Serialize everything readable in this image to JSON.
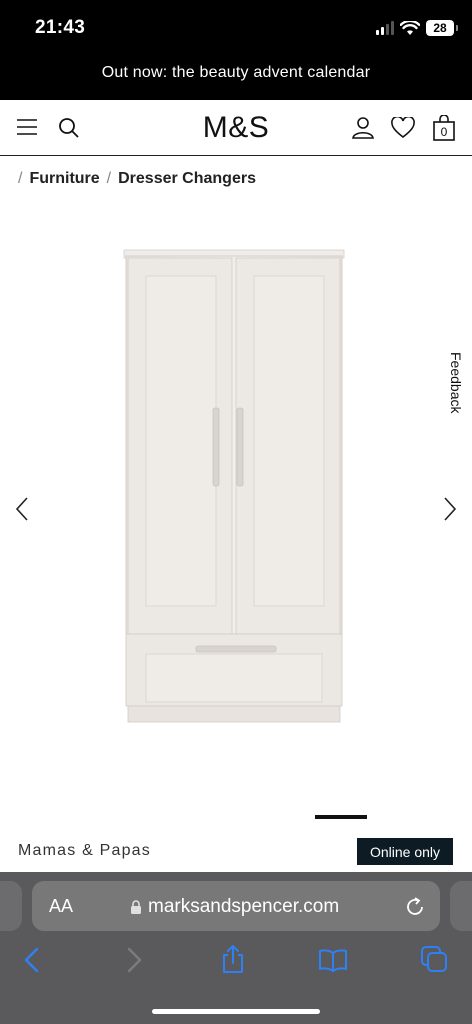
{
  "status": {
    "time": "21:43",
    "battery": "28"
  },
  "promo": {
    "text": "Out now: the beauty advent calendar"
  },
  "header": {
    "logo": "M&S",
    "menu_icon": "menu-icon",
    "search_icon": "search-icon",
    "account_icon": "account-icon",
    "wishlist_icon": "heart-icon",
    "bag_icon": "bag-icon",
    "bag_count": "0"
  },
  "breadcrumb": {
    "items": [
      "Furniture",
      "Dresser Changers"
    ],
    "separator": "/"
  },
  "product": {
    "image": "wardrobe-image",
    "brand": "Mamas & Papas",
    "badge": "Online only"
  },
  "feedback": {
    "label": "Feedback"
  },
  "browser": {
    "text_size_label": "AA",
    "url": "marksandspencer.com",
    "icons": [
      "lock-icon",
      "reload-icon",
      "back-icon",
      "forward-icon",
      "share-icon",
      "bookmarks-icon",
      "tabs-icon"
    ]
  },
  "colors": {
    "status_bar": "#000000",
    "badge_bg": "#0d1b24",
    "browser_bar": "#5a5a5c",
    "link_blue": "#2f7ff5"
  }
}
